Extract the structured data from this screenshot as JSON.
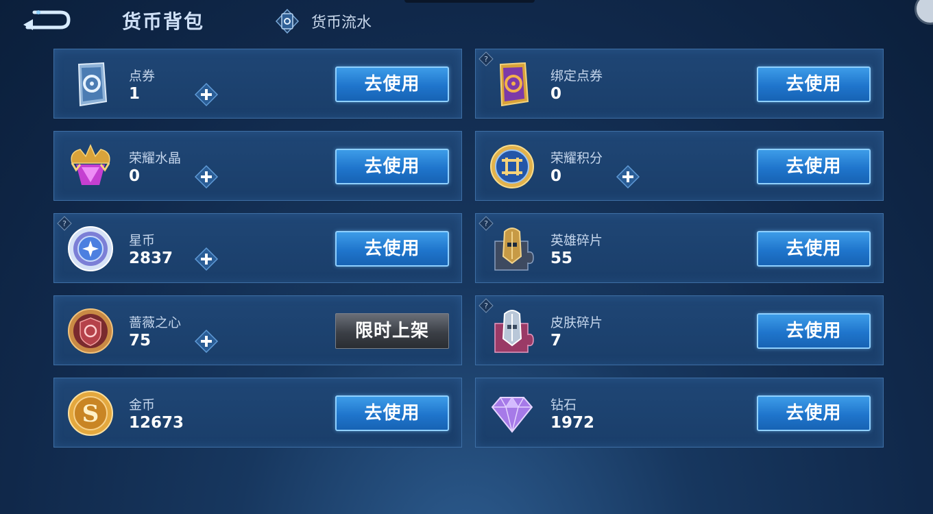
{
  "header": {
    "title": "货币背包",
    "flow_link_label": "货币流水"
  },
  "cards": [
    {
      "name": "点券",
      "amount": "1",
      "button": "去使用"
    },
    {
      "name": "绑定点券",
      "amount": "0",
      "button": "去使用"
    },
    {
      "name": "荣耀水晶",
      "amount": "0",
      "button": "去使用"
    },
    {
      "name": "荣耀积分",
      "amount": "0",
      "button": "去使用"
    },
    {
      "name": "星币",
      "amount": "2837",
      "button": "去使用"
    },
    {
      "name": "英雄碎片",
      "amount": "55",
      "button": "去使用"
    },
    {
      "name": "蔷薇之心",
      "amount": "75",
      "button": "限时上架"
    },
    {
      "name": "皮肤碎片",
      "amount": "7",
      "button": "去使用"
    },
    {
      "name": "金币",
      "amount": "12673",
      "button": "去使用"
    },
    {
      "name": "钻石",
      "amount": "1972",
      "button": "去使用"
    }
  ],
  "colors": {
    "card_bg": "#1d4370",
    "card_border": "#3e6fa5",
    "button_blue": "#2a86dc",
    "button_gray": "#4a4e55"
  },
  "icons": [
    "back-arrow-icon",
    "currency-flow-icon",
    "coupon-icon",
    "bound-coupon-icon",
    "glory-crystal-icon",
    "glory-points-icon",
    "star-coin-icon",
    "hero-fragment-icon",
    "rose-heart-icon",
    "skin-fragment-icon",
    "gold-coin-icon",
    "diamond-icon",
    "plus-icon",
    "help-icon"
  ]
}
